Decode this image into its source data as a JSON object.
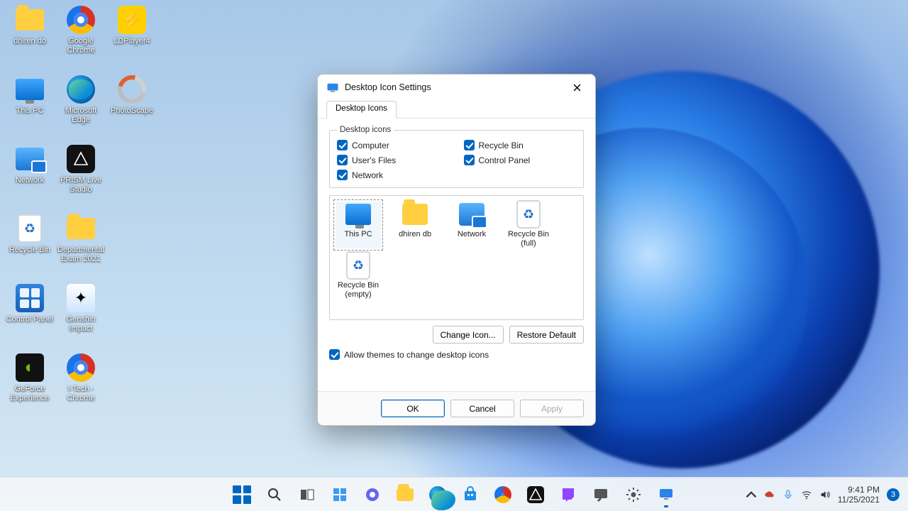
{
  "desktop": {
    "icons": [
      {
        "label": "dhiren db",
        "kind": "folder"
      },
      {
        "label": "Google Chrome",
        "kind": "chrome"
      },
      {
        "label": "LDPlayer4",
        "kind": "ld"
      },
      {
        "label": "This PC",
        "kind": "monitor"
      },
      {
        "label": "Microsoft Edge",
        "kind": "edge"
      },
      {
        "label": "PhotoScape",
        "kind": "photo"
      },
      {
        "label": "Network",
        "kind": "net"
      },
      {
        "label": "PRISM Live Studio",
        "kind": "prism"
      },
      {
        "label": "",
        "kind": "blank"
      },
      {
        "label": "Recycle Bin",
        "kind": "recycle"
      },
      {
        "label": "Departmental Exam 2021",
        "kind": "folder"
      },
      {
        "label": "",
        "kind": "blank"
      },
      {
        "label": "Control Panel",
        "kind": "cpanel"
      },
      {
        "label": "Genshin Impact",
        "kind": "genshin"
      },
      {
        "label": "",
        "kind": "blank"
      },
      {
        "label": "GeForce Experience",
        "kind": "nvidia"
      },
      {
        "label": "I-Tech - Chrome",
        "kind": "chrome"
      }
    ]
  },
  "dialog": {
    "title": "Desktop Icon Settings",
    "tab": "Desktop Icons",
    "group_label": "Desktop icons",
    "checks": [
      {
        "label": "Computer",
        "checked": true
      },
      {
        "label": "Recycle Bin",
        "checked": true
      },
      {
        "label": "User's Files",
        "checked": true
      },
      {
        "label": "Control Panel",
        "checked": true
      },
      {
        "label": "Network",
        "checked": true
      }
    ],
    "icon_tiles": [
      {
        "label": "This PC",
        "kind": "monitor",
        "selected": true
      },
      {
        "label": "dhiren db",
        "kind": "folder"
      },
      {
        "label": "Network",
        "kind": "net"
      },
      {
        "label": "Recycle Bin (full)",
        "kind": "recycle"
      },
      {
        "label": "Recycle Bin (empty)",
        "kind": "recycle"
      }
    ],
    "change_icon": "Change Icon...",
    "restore_default": "Restore Default",
    "allow_themes": "Allow themes to change desktop icons",
    "allow_themes_checked": true,
    "ok": "OK",
    "cancel": "Cancel",
    "apply": "Apply"
  },
  "taskbar": {
    "items": [
      "start",
      "search",
      "taskview",
      "widgets",
      "chat",
      "explorer",
      "edge",
      "store",
      "chrome",
      "prism",
      "twitch",
      "chat2",
      "settings",
      "display"
    ],
    "tray": {
      "chevron": "^",
      "time": "9:41 PM",
      "date": "11/25/2021",
      "badge": "3"
    }
  }
}
